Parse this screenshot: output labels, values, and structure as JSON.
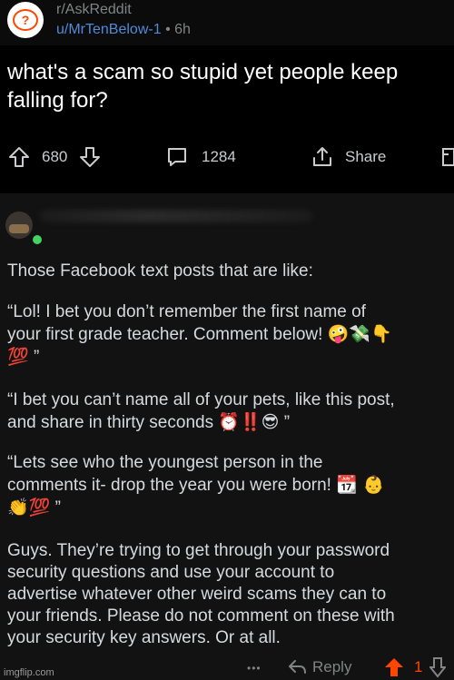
{
  "post": {
    "subreddit": "r/AskReddit",
    "username": "u/MrTenBelow-1",
    "separator": "•",
    "age": "6h",
    "title": "what's a scam so stupid yet people keep falling for?",
    "title_line1": "what's a scam so stupid yet people keep",
    "title_line2": "falling for?"
  },
  "actions": {
    "upvotes": "680",
    "comments": "1284",
    "share": "Share"
  },
  "comment": {
    "p1": "Those Facebook text posts that are like:",
    "p2_line1": "“Lol! I bet you don’t remember the first name of",
    "p2_line2": "your first grade teacher. Comment below!",
    "p2_emoji": "🤪💸👇",
    "p2_line3_emoji": "💯",
    "p2_close": " ”",
    "p3_line1": "“I bet you can’t name all of your pets, like this post,",
    "p3_line2": "and share in thirty seconds",
    "p3_emoji": "⏰‼️😎",
    "p3_close": " ”",
    "p4_line1": "“Lets see who the youngest person in the",
    "p4_line2": "comments it- drop the year you were born!",
    "p4_emoji": "📆 👶",
    "p4_line3_emoji": "👏💯",
    "p4_close": " ”",
    "p5_line1": "Guys. They’re trying to get through your password",
    "p5_line2": "security questions and use your account to",
    "p5_line3": "advertise whatever other weird scams they can to",
    "p5_line4": "your friends. Please do not comment on these with",
    "p5_line5": "your security key answers. Or at all."
  },
  "footer": {
    "more": "•••",
    "reply": "Reply",
    "score": "1",
    "watermark": "imgflip.com"
  },
  "colors": {
    "accent": "#ff4500",
    "username": "#4f8bd9",
    "online": "#46d160"
  }
}
